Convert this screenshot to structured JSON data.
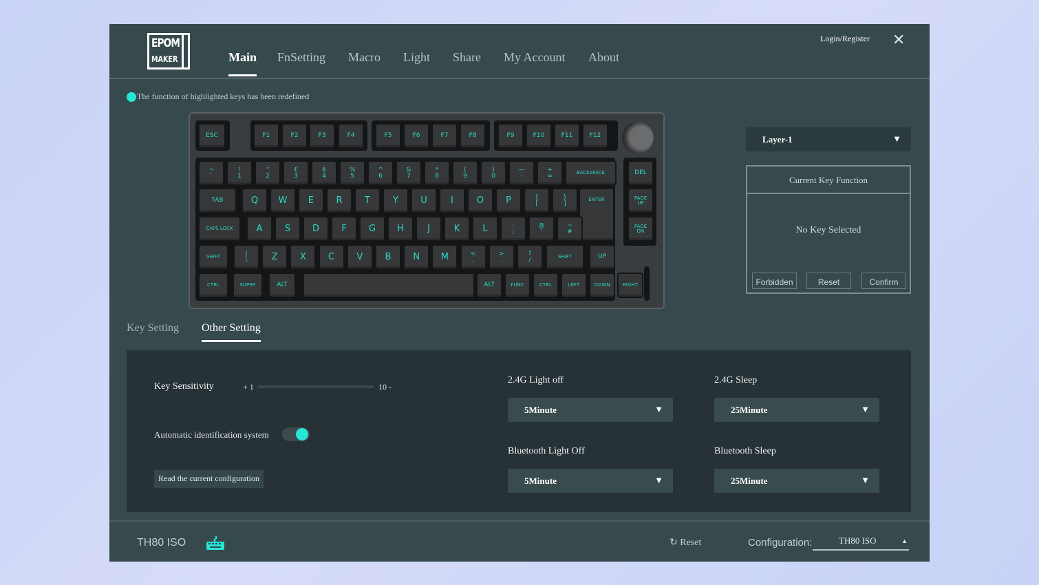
{
  "header": {
    "logo_text": "EPOM MAKER",
    "nav": [
      "Main",
      "FnSetting",
      "Macro",
      "Light",
      "Share",
      "My Account",
      "About"
    ],
    "active_nav": "Main",
    "login": "Login/Register",
    "close_icon": "close-icon"
  },
  "notice": "The function of highlighted keys has been redefined",
  "keyboard": {
    "rows": [
      [
        "ESC",
        "F1",
        "F2",
        "F3",
        "F4",
        "F5",
        "F6",
        "F7",
        "F8",
        "F9",
        "F10",
        "F11",
        "F12"
      ],
      [
        "¬\n`",
        "!\n1",
        "\"\n2",
        "£\n3",
        "$\n4",
        "%\n5",
        "^\n6",
        "&\n7",
        "*\n8",
        "(\n9",
        ")\n0",
        "—\n-",
        "+\n=",
        "BACKSPACE",
        "DEL"
      ],
      [
        "TAB",
        "Q",
        "W",
        "E",
        "R",
        "T",
        "Y",
        "U",
        "I",
        "O",
        "P",
        "{\n[",
        "}\n]",
        "ENTER",
        "PAGE\nUP"
      ],
      [
        "CAPS LOCK",
        "A",
        "S",
        "D",
        "F",
        "G",
        "H",
        "J",
        "K",
        "L",
        ":\n;",
        "@\n'",
        "~\n#",
        "PAGE\nDN"
      ],
      [
        "SHIFT",
        "|\n\\",
        "Z",
        "X",
        "C",
        "V",
        "B",
        "N",
        "M",
        "<\n,",
        ">\n.",
        "?\n/",
        "SHIFT",
        "UP"
      ],
      [
        "CTRL",
        "SUPER",
        "ALT",
        "",
        "ALT",
        "FUNC",
        "CTRL",
        "LEFT",
        "DOWN",
        "RIGHT"
      ]
    ],
    "legend_color": "#2ad8c5"
  },
  "layer": {
    "value": "Layer-1"
  },
  "key_function": {
    "title": "Current Key Function",
    "status": "No Key Selected",
    "buttons": [
      "Forbidden",
      "Reset",
      "Confirm"
    ]
  },
  "tabs": [
    "Key Setting",
    "Other Setting"
  ],
  "active_tab": "Other Setting",
  "other": {
    "sensitivity": {
      "label": "Key Sensitivity",
      "min_label": "+ 1",
      "max_label": "10 -"
    },
    "auto_id": {
      "label": "Automatic identification system",
      "enabled": true
    },
    "read_config": "Read the current configuration",
    "light_off_24g": {
      "label": "2.4G Light off",
      "value": "5Minute"
    },
    "sleep_24g": {
      "label": "2.4G Sleep",
      "value": "25Minute"
    },
    "bt_light_off": {
      "label": "Bluetooth Light Off",
      "value": "5Minute"
    },
    "bt_sleep": {
      "label": "Bluetooth Sleep",
      "value": "25Minute"
    }
  },
  "footer": {
    "model": "TH80 ISO",
    "reset": "Reset",
    "config_label": "Configuration:",
    "config_value": "TH80 ISO"
  },
  "colors": {
    "accent": "#27e6d6",
    "app_bg": "#36494c",
    "panel_bg": "#263236"
  }
}
